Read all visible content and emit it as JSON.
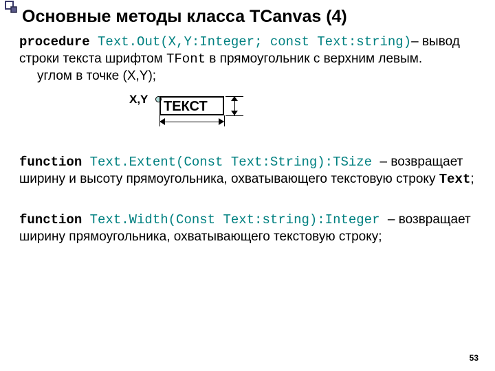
{
  "title": "Основные методы класса TCanvas (4)",
  "item1": {
    "kw": "procedure",
    "sig": " Text.Out(X,Y:Integer; const Text:string)",
    "after": "– вывод строки текста шрифтом ",
    "tfont": "TFont",
    "tail1": " в прямоугольник с верхним левым.",
    "tail2": "углом в точке (X,Y);"
  },
  "diagram": {
    "xy": "X,Y",
    "text": "ТЕКСТ"
  },
  "item2": {
    "kw": "function",
    "sig": " Text.Extent(Const Text:String):TSize ",
    "after": "– возвращает ширину и высоту прямоугольника, охватывающего текстовую строку ",
    "textref": "Text",
    "semi": ";"
  },
  "item3": {
    "kw": "function",
    "sig": " Text.Width(Const Text:string):Integer ",
    "after": "– возвращает ширину прямоугольника, охватывающего текстовую строку;"
  },
  "page": "53"
}
